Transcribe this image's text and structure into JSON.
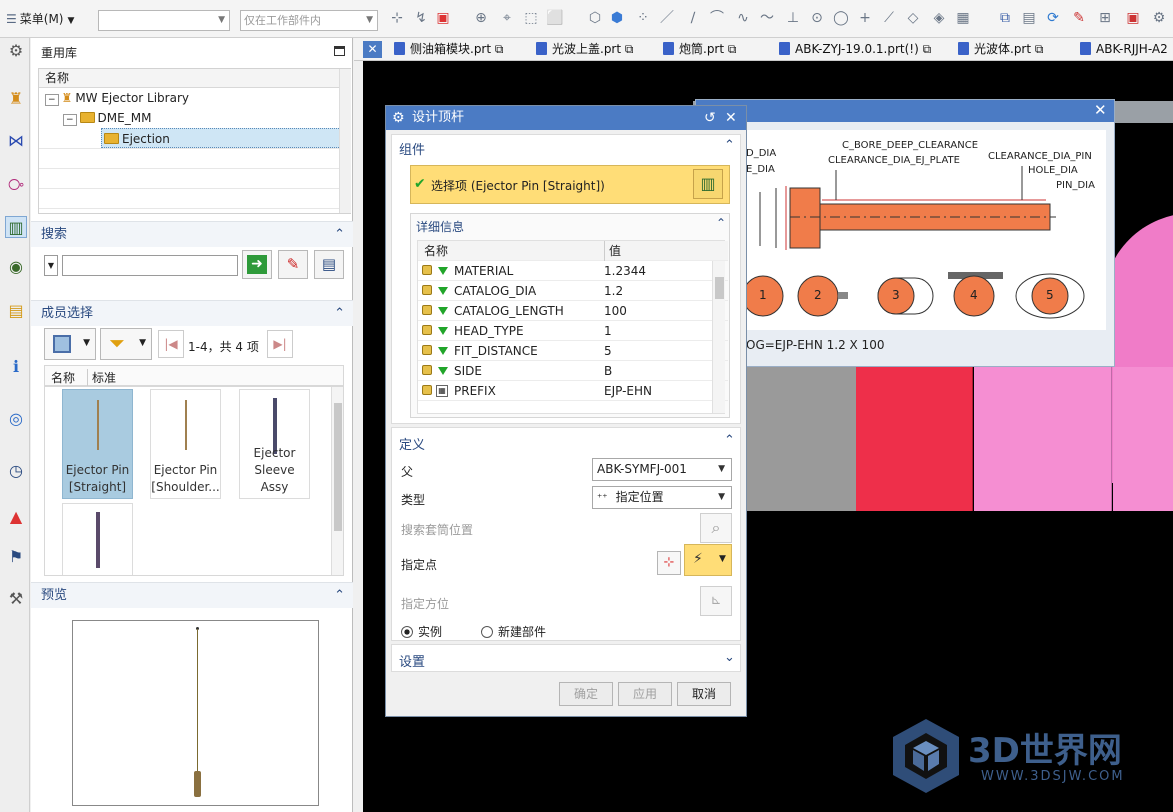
{
  "toolbar": {
    "menu_label": "菜单(M)",
    "filter_value": "",
    "scope_placeholder": "仅在工作部件内"
  },
  "left": {
    "library_title": "重用库",
    "tree_header": "名称",
    "tree": [
      {
        "label": "MW Ejector Library"
      },
      {
        "label": "DME_MM"
      },
      {
        "label": "Ejection"
      }
    ],
    "search_title": "搜索",
    "search_value": "",
    "member_title": "成员选择",
    "paging": "1-4，共 4 项",
    "member_columns": [
      "名称",
      "标准"
    ],
    "members": [
      "Ejector Pin [Straight]",
      "Ejector Pin [Shoulder...",
      "Ejector Sleeve Assy",
      ""
    ],
    "preview_title": "预览"
  },
  "tabs": [
    "侧油箱模块.prt",
    "光波上盖.prt",
    "炮筒.prt",
    "ABK-ZYJ-19.0.1.prt(!)",
    "光波体.prt",
    "ABK-RJJH-A2"
  ],
  "dialog": {
    "title": "设计顶杆",
    "group_component": "组件",
    "selected_item": "选择项 (Ejector Pin [Straight])",
    "details_title": "详细信息",
    "col_name": "名称",
    "col_value": "值",
    "rows": [
      {
        "name": "MATERIAL",
        "value": "1.2344"
      },
      {
        "name": "CATALOG_DIA",
        "value": "1.2"
      },
      {
        "name": "CATALOG_LENGTH",
        "value": "100"
      },
      {
        "name": "HEAD_TYPE",
        "value": "1"
      },
      {
        "name": "FIT_DISTANCE",
        "value": "5"
      },
      {
        "name": "SIDE",
        "value": "B"
      },
      {
        "name": "PREFIX",
        "value": "EJP-EHN"
      }
    ],
    "group_define": "定义",
    "parent_label": "父",
    "parent_value": "ABK-SYMFJ-001",
    "type_label": "类型",
    "type_value": "指定位置",
    "search_sleeve_label": "搜索套筒位置",
    "specify_point_label": "指定点",
    "specify_orientation_label": "指定方位",
    "radio_instance": "实例",
    "radio_new_part": "新建部件",
    "group_settings": "设置",
    "ok": "确定",
    "apply": "应用",
    "cancel": "取消"
  },
  "drawing": {
    "labels": [
      "D_DIA",
      "E_DIA",
      "C_BORE_DEEP_CLEARANCE",
      "CLEARANCE_DIA_EJ_PLATE",
      "CLEARANCE_DIA_PIN",
      "HOLE_DIA",
      "PIN_DIA"
    ],
    "head_numbers": [
      "1",
      "2",
      "3",
      "4",
      "5"
    ],
    "catalog": "OG=EJP-EHN 1.2 X 100"
  },
  "watermark": {
    "brand": "3D世界网",
    "url": "WWW.3DSJW.COM"
  },
  "colors": {
    "accent": "#4b7bc4",
    "highlight": "#ffdd77",
    "pin": "#f07c4a"
  }
}
